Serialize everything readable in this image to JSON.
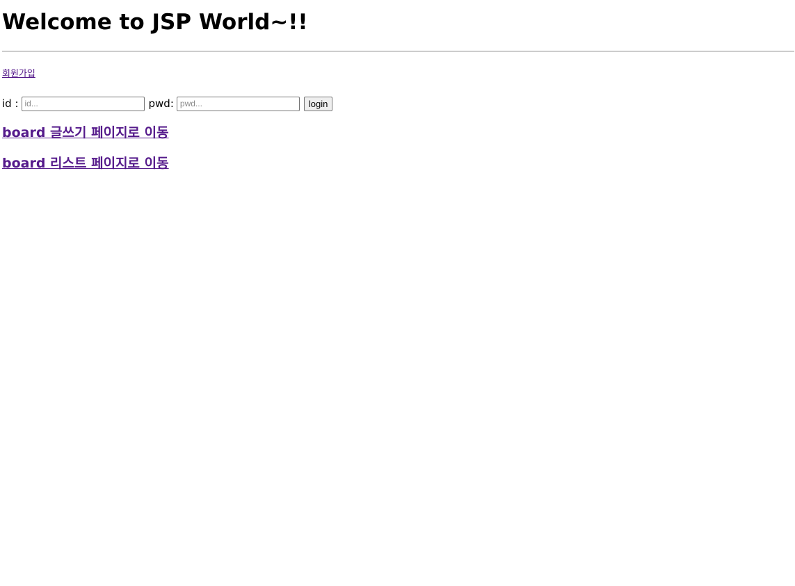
{
  "header": {
    "title": "Welcome to JSP World~!!"
  },
  "nav": {
    "signup_label": "회원가입"
  },
  "login_form": {
    "id_label": "id :",
    "id_placeholder": "id...",
    "pwd_label": "pwd:",
    "pwd_placeholder": "pwd...",
    "submit_label": "login"
  },
  "links": {
    "board_write": "board 글쓰기 페이지로 이동",
    "board_list": "board 리스트 페이지로 이동"
  },
  "colors": {
    "visited_link": "#551a8b",
    "divider": "#9a9a9a"
  }
}
